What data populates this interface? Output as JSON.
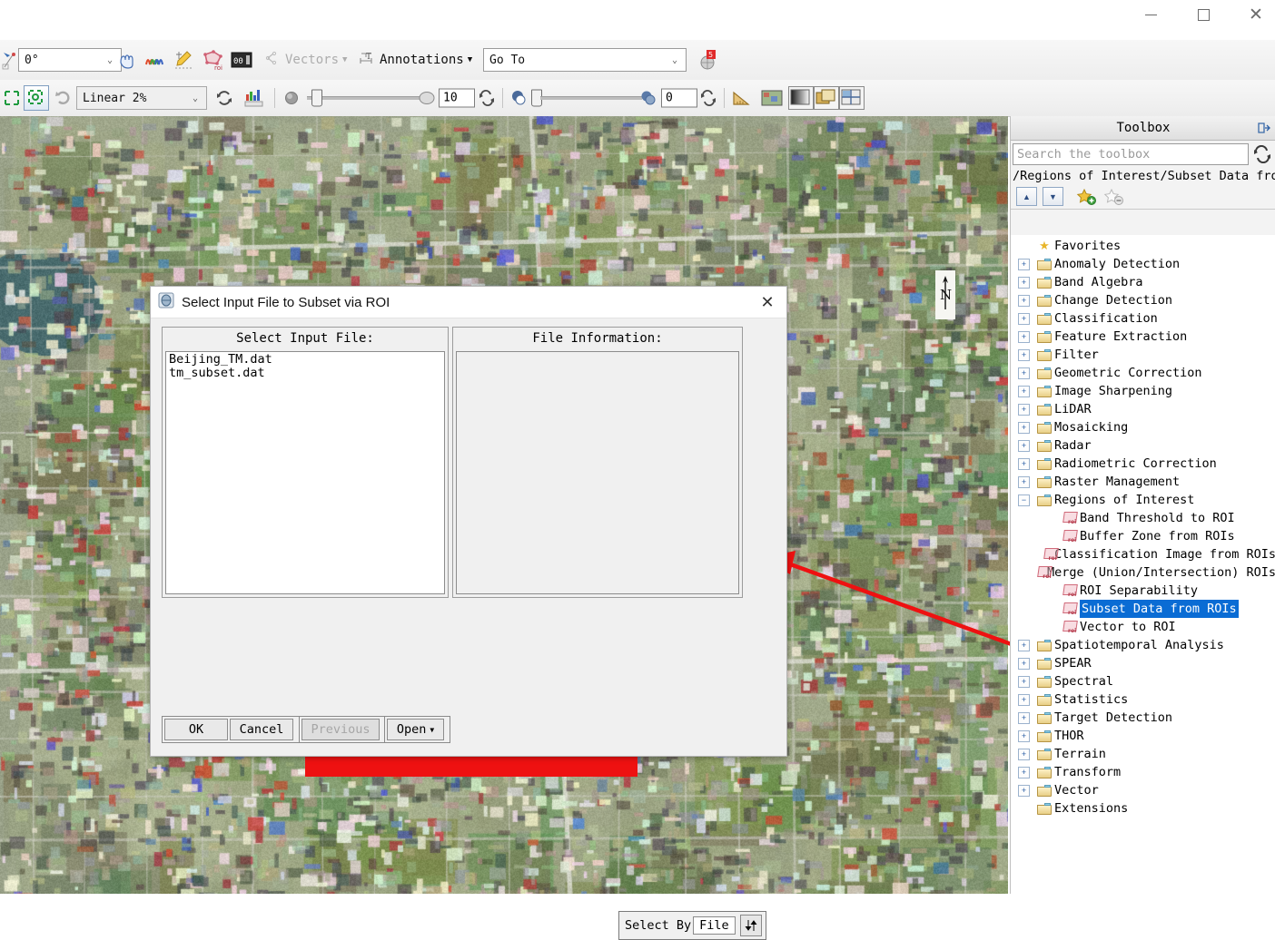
{
  "window": {
    "controls": [
      {
        "name": "minimize",
        "glyph": "—"
      },
      {
        "name": "maximize",
        "glyph": "□"
      },
      {
        "name": "close",
        "glyph": "✕"
      }
    ]
  },
  "toolbar_row1": {
    "rotation": {
      "value": "0°",
      "placeholder": "0°"
    },
    "icons": [
      {
        "name": "rotate-tool-icon",
        "title": "Rotate"
      },
      {
        "name": "pan-hand-icon",
        "title": "Pan"
      },
      {
        "name": "spectral-profile-icon",
        "title": "Spectral Profile"
      },
      {
        "name": "annotation-pencil-icon",
        "title": "Annotation"
      },
      {
        "name": "roi-tool-icon",
        "title": "Region of Interest"
      },
      {
        "name": "pixel-values-icon",
        "title": "Cursor Value"
      }
    ],
    "vectors_label": "Vectors",
    "annotations_label": "Annotations",
    "goto": {
      "value": "Go To",
      "placeholder": "Go To"
    },
    "portal_icon": {
      "name": "portal-badge-icon",
      "badge": "5"
    }
  },
  "toolbar_row2": {
    "stretch": {
      "value": "Linear 2%"
    },
    "brightness": {
      "value": "10",
      "label": "Brightness"
    },
    "contrast": {
      "value": "0",
      "label": "Contrast"
    },
    "icons": [
      {
        "name": "zoom-to-extent-icon"
      },
      {
        "name": "crop-frame-icon"
      },
      {
        "name": "refresh-stretch-icon"
      },
      {
        "name": "histogram-icon"
      },
      {
        "name": "reset-brightness-icon"
      },
      {
        "name": "reset-contrast-icon"
      },
      {
        "name": "measure-tool-icon"
      },
      {
        "name": "image-display-icon"
      },
      {
        "name": "blend-view-icon"
      },
      {
        "name": "flicker-view-icon"
      },
      {
        "name": "swipe-view-icon"
      }
    ]
  },
  "map": {
    "north_arrow": "N",
    "annotation_color": "#ee1111"
  },
  "dialog": {
    "title": "Select Input File to Subset via ROI",
    "close_label": "✕",
    "input_panel": {
      "header": "Select Input File:",
      "files": [
        "Beijing_TM.dat",
        "tm_subset.dat"
      ]
    },
    "info_panel": {
      "header": "File Information:",
      "content": ""
    },
    "select_by": {
      "label": "Select By",
      "value": "File",
      "swap_glyph": "⇵"
    },
    "buttons": {
      "ok": "OK",
      "cancel": "Cancel",
      "previous": "Previous",
      "open": "Open",
      "open_caret": "▼"
    }
  },
  "toolbox": {
    "title": "Toolbox",
    "pin_icon": "pin-panel-icon",
    "search": {
      "placeholder": "Search the toolbox",
      "value": ""
    },
    "refresh_icon": "refresh-icon",
    "path": "/Regions of Interest/Subset Data from R",
    "nav": {
      "up": "▲",
      "down": "▼",
      "add_favorite": "add-favorite-star-icon",
      "remove_favorite": "remove-favorite-star-icon"
    },
    "tree": [
      {
        "label": "Favorites",
        "icon": "star",
        "expander": "none",
        "depth": 0,
        "selected": false
      },
      {
        "label": "Anomaly Detection",
        "icon": "folder",
        "expander": "plus",
        "depth": 0,
        "selected": false
      },
      {
        "label": "Band Algebra",
        "icon": "folder",
        "expander": "plus",
        "depth": 0,
        "selected": false
      },
      {
        "label": "Change Detection",
        "icon": "folder",
        "expander": "plus",
        "depth": 0,
        "selected": false
      },
      {
        "label": "Classification",
        "icon": "folder",
        "expander": "plus",
        "depth": 0,
        "selected": false
      },
      {
        "label": "Feature Extraction",
        "icon": "folder",
        "expander": "plus",
        "depth": 0,
        "selected": false
      },
      {
        "label": "Filter",
        "icon": "folder",
        "expander": "plus",
        "depth": 0,
        "selected": false
      },
      {
        "label": "Geometric Correction",
        "icon": "folder",
        "expander": "plus",
        "depth": 0,
        "selected": false
      },
      {
        "label": "Image Sharpening",
        "icon": "folder",
        "expander": "plus",
        "depth": 0,
        "selected": false
      },
      {
        "label": "LiDAR",
        "icon": "folder",
        "expander": "plus",
        "depth": 0,
        "selected": false
      },
      {
        "label": "Mosaicking",
        "icon": "folder",
        "expander": "plus",
        "depth": 0,
        "selected": false
      },
      {
        "label": "Radar",
        "icon": "folder",
        "expander": "plus",
        "depth": 0,
        "selected": false
      },
      {
        "label": "Radiometric Correction",
        "icon": "folder",
        "expander": "plus",
        "depth": 0,
        "selected": false
      },
      {
        "label": "Raster Management",
        "icon": "folder",
        "expander": "plus",
        "depth": 0,
        "selected": false
      },
      {
        "label": "Regions of Interest",
        "icon": "folder",
        "expander": "minus",
        "depth": 0,
        "selected": false
      },
      {
        "label": "Band Threshold to ROI",
        "icon": "roi",
        "expander": "none",
        "depth": 1,
        "selected": false
      },
      {
        "label": "Buffer Zone from ROIs",
        "icon": "roi",
        "expander": "none",
        "depth": 1,
        "selected": false
      },
      {
        "label": "Classification Image from ROIs",
        "icon": "roi",
        "expander": "none",
        "depth": 1,
        "selected": false
      },
      {
        "label": "Merge (Union/Intersection) ROIs",
        "icon": "roi",
        "expander": "none",
        "depth": 1,
        "selected": false
      },
      {
        "label": "ROI Separability",
        "icon": "roi",
        "expander": "none",
        "depth": 1,
        "selected": false
      },
      {
        "label": "Subset Data from ROIs",
        "icon": "roi",
        "expander": "none",
        "depth": 1,
        "selected": true
      },
      {
        "label": "Vector to ROI",
        "icon": "roi",
        "expander": "none",
        "depth": 1,
        "selected": false
      },
      {
        "label": "Spatiotemporal Analysis",
        "icon": "folder",
        "expander": "plus",
        "depth": 0,
        "selected": false
      },
      {
        "label": "SPEAR",
        "icon": "folder",
        "expander": "plus",
        "depth": 0,
        "selected": false
      },
      {
        "label": "Spectral",
        "icon": "folder",
        "expander": "plus",
        "depth": 0,
        "selected": false
      },
      {
        "label": "Statistics",
        "icon": "folder",
        "expander": "plus",
        "depth": 0,
        "selected": false
      },
      {
        "label": "Target Detection",
        "icon": "folder",
        "expander": "plus",
        "depth": 0,
        "selected": false
      },
      {
        "label": "THOR",
        "icon": "folder",
        "expander": "plus",
        "depth": 0,
        "selected": false
      },
      {
        "label": "Terrain",
        "icon": "folder",
        "expander": "plus",
        "depth": 0,
        "selected": false
      },
      {
        "label": "Transform",
        "icon": "folder",
        "expander": "plus",
        "depth": 0,
        "selected": false
      },
      {
        "label": "Vector",
        "icon": "folder",
        "expander": "plus",
        "depth": 0,
        "selected": false
      },
      {
        "label": "Extensions",
        "icon": "folder",
        "expander": "none",
        "depth": 0,
        "selected": false
      }
    ]
  }
}
